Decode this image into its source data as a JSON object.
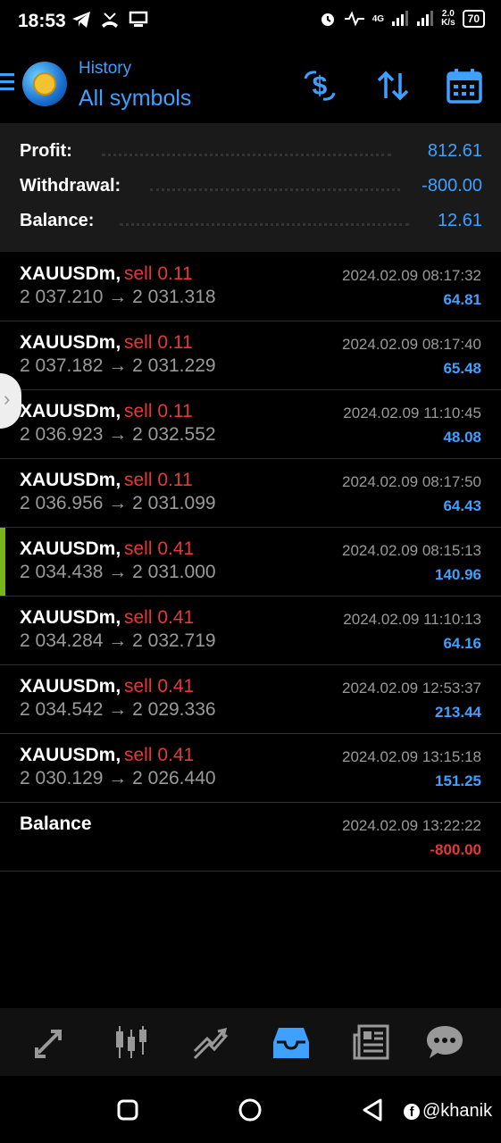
{
  "status": {
    "time": "18:53",
    "speed_top": "2.0",
    "speed_bottom": "K/s",
    "network": "4G",
    "battery": "70"
  },
  "header": {
    "subtitle": "History",
    "title": "All symbols"
  },
  "summary": {
    "profit_label": "Profit:",
    "profit_value": "812.61",
    "withdrawal_label": "Withdrawal:",
    "withdrawal_value": "-800.00",
    "balance_label": "Balance:",
    "balance_value": "12.61"
  },
  "trades": [
    {
      "symbol": "XAUUSDm,",
      "side": "sell 0.11",
      "open": "2 037.210",
      "close": "2 031.318",
      "date": "2024.02.09 08:17:32",
      "profit": "64.81"
    },
    {
      "symbol": "XAUUSDm,",
      "side": "sell 0.11",
      "open": "2 037.182",
      "close": "2 031.229",
      "date": "2024.02.09 08:17:40",
      "profit": "65.48"
    },
    {
      "symbol": "XAUUSDm,",
      "side": "sell 0.11",
      "open": "2 036.923",
      "close": "2 032.552",
      "date": "2024.02.09 11:10:45",
      "profit": "48.08"
    },
    {
      "symbol": "XAUUSDm,",
      "side": "sell 0.11",
      "open": "2 036.956",
      "close": "2 031.099",
      "date": "2024.02.09 08:17:50",
      "profit": "64.43"
    },
    {
      "symbol": "XAUUSDm,",
      "side": "sell 0.41",
      "open": "2 034.438",
      "close": "2 031.000",
      "date": "2024.02.09 08:15:13",
      "profit": "140.96"
    },
    {
      "symbol": "XAUUSDm,",
      "side": "sell 0.41",
      "open": "2 034.284",
      "close": "2 032.719",
      "date": "2024.02.09 11:10:13",
      "profit": "64.16"
    },
    {
      "symbol": "XAUUSDm,",
      "side": "sell 0.41",
      "open": "2 034.542",
      "close": "2 029.336",
      "date": "2024.02.09 12:53:37",
      "profit": "213.44"
    },
    {
      "symbol": "XAUUSDm,",
      "side": "sell 0.41",
      "open": "2 030.129",
      "close": "2 026.440",
      "date": "2024.02.09 13:15:18",
      "profit": "151.25"
    }
  ],
  "balance_op": {
    "label": "Balance",
    "date": "2024.02.09 13:22:22",
    "amount": "-800.00"
  },
  "arrow_glyph": "→",
  "watermark": "@khanik",
  "colors": {
    "accent": "#3ea0ff",
    "sell": "#e53935",
    "active_marker": "#7ab51d"
  }
}
